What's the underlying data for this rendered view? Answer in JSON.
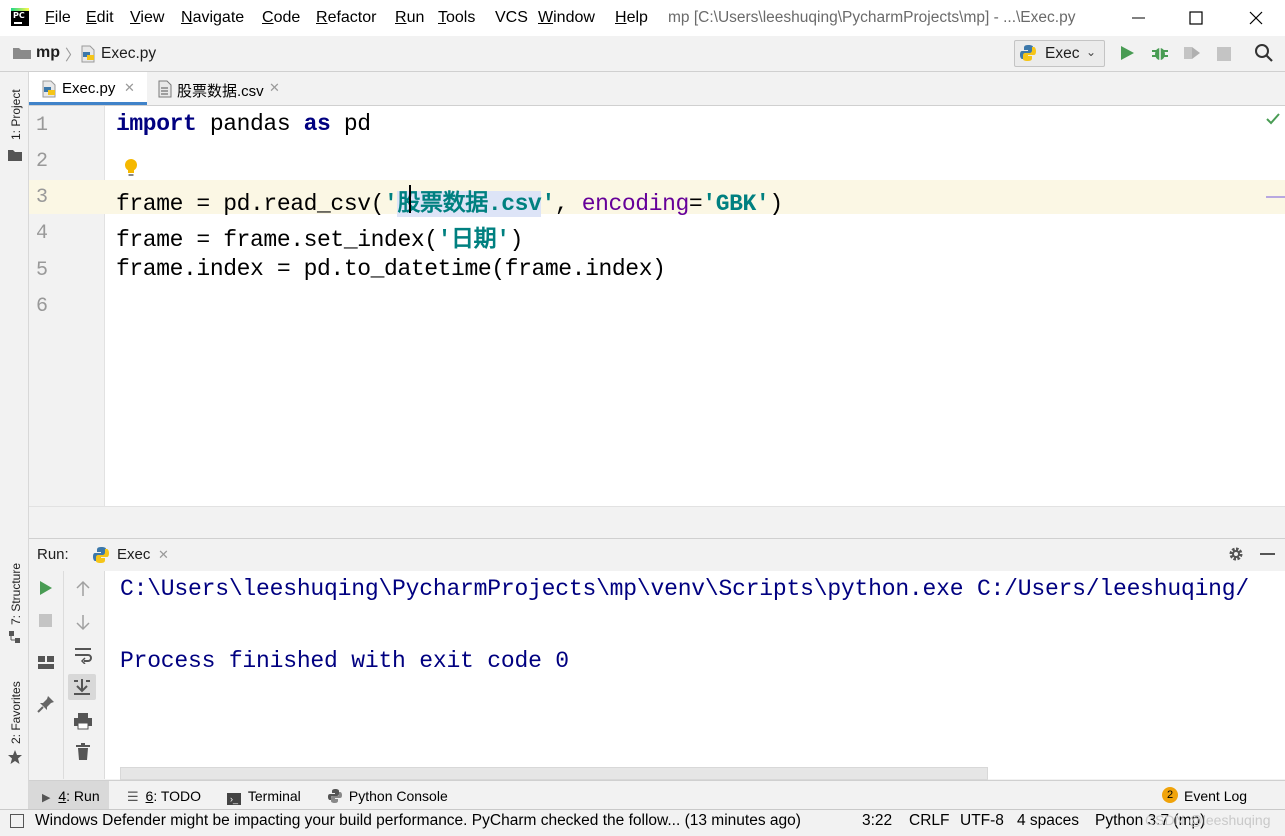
{
  "window": {
    "title": "mp [C:\\Users\\leeshuqing\\PycharmProjects\\mp] - ...\\Exec.py",
    "menu": [
      {
        "label": "File",
        "underline": "F",
        "rest": "ile"
      },
      {
        "label": "Edit",
        "underline": "E",
        "rest": "dit"
      },
      {
        "label": "View",
        "underline": "V",
        "rest": "iew"
      },
      {
        "label": "Navigate",
        "underline": "N",
        "rest": "avigate"
      },
      {
        "label": "Code",
        "underline": "C",
        "rest": "ode"
      },
      {
        "label": "Refactor",
        "underline": "R",
        "rest": "efactor"
      },
      {
        "label": "Run",
        "underline": "R",
        "rest": "un"
      },
      {
        "label": "Tools",
        "underline": "T",
        "rest": "ools"
      },
      {
        "label": "VCS",
        "underline": "",
        "rest": "VCS"
      },
      {
        "label": "Window",
        "underline": "W",
        "rest": "indow"
      },
      {
        "label": "Help",
        "underline": "H",
        "rest": "elp"
      }
    ]
  },
  "navbar": {
    "project": "mp",
    "file": "Exec.py",
    "run_config": "Exec"
  },
  "sidebar": {
    "project_tab": "1: Project",
    "structure_tab": "7: Structure",
    "favorites_tab": "2: Favorites"
  },
  "tabs": [
    {
      "label": "Exec.py",
      "active": true
    },
    {
      "label": "股票数据.csv",
      "active": false
    }
  ],
  "editor": {
    "line_numbers": [
      "1",
      "2",
      "3",
      "4",
      "5",
      "6"
    ],
    "line1": {
      "kw1": "import",
      "t1": " pandas ",
      "kw2": "as",
      "t2": " pd"
    },
    "line3": {
      "t1": "frame = pd.read_csv(",
      "s1": "'",
      "s2": "股票数据.csv",
      "s3": "'",
      "t2": ", ",
      "param": "encoding",
      "t3": "=",
      "s4": "'GBK'",
      "t4": ")"
    },
    "line4": {
      "t1": "frame = frame.set_index(",
      "s1": "'日期'",
      "t2": ")"
    },
    "line5": {
      "t1": "frame.index = pd.to_datetime(frame.index)"
    }
  },
  "run_panel": {
    "label": "Run:",
    "tab": "Exec",
    "output": [
      "C:\\Users\\leeshuqing\\PycharmProjects\\mp\\venv\\Scripts\\python.exe C:/Users/leeshuqing/",
      "",
      "Process finished with exit code 0"
    ]
  },
  "tool_windows": [
    {
      "num": "4",
      "label": ": Run"
    },
    {
      "num": "6",
      "label": ": TODO"
    },
    {
      "num": "",
      "label": "Terminal"
    },
    {
      "num": "",
      "label": "Python Console"
    }
  ],
  "event_log": {
    "count": "2",
    "label": "Event Log"
  },
  "status": {
    "message": "Windows Defender might be impacting your build performance. PyCharm checked the follow... (13 minutes ago)",
    "position": "3:22",
    "line_sep": "CRLF",
    "encoding": "UTF-8",
    "indent": "4 spaces",
    "interpreter": "Python 3.7 (mp)",
    "watermark": "CSDN @leeshuqing"
  },
  "colors": {
    "keyword": "#000080",
    "string": "#008080",
    "param": "#660099",
    "console_text": "#000080",
    "run_green": "#499c54",
    "tab_underline": "#4083c9"
  }
}
